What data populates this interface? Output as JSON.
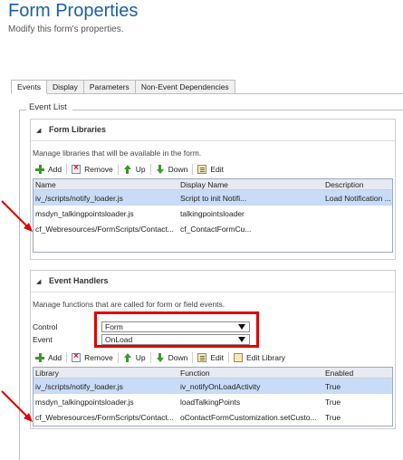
{
  "header": {
    "title": "Form Properties",
    "subtitle": "Modify this form's properties."
  },
  "tabs": [
    {
      "label": "Events",
      "active": true
    },
    {
      "label": "Display",
      "active": false
    },
    {
      "label": "Parameters",
      "active": false
    },
    {
      "label": "Non-Event Dependencies",
      "active": false
    }
  ],
  "event_list": {
    "label": "Event List",
    "form_libraries": {
      "title": "Form Libraries",
      "description": "Manage libraries that will be available in the form.",
      "toolbar": {
        "add": "Add",
        "remove": "Remove",
        "up": "Up",
        "down": "Down",
        "edit": "Edit"
      },
      "columns": [
        "Name",
        "Display Name",
        "Description"
      ],
      "rows": [
        {
          "name": "iv_/scripts/notify_loader.js",
          "display": "Script to init Notifi...",
          "desc": "Load Notification ...",
          "selected": true
        },
        {
          "name": "msdyn_talkingpointsloader.js",
          "display": "talkingpointsloader",
          "desc": "",
          "selected": false
        },
        {
          "name": "cf_Webresources/FormScripts/Contact...",
          "display": "cf_ContactFormCu...",
          "desc": "",
          "selected": false
        }
      ]
    },
    "event_handlers": {
      "title": "Event Handlers",
      "description": "Manage functions that are called for form or field events.",
      "control_label": "Control",
      "control_value": "Form",
      "event_label": "Event",
      "event_value": "OnLoad",
      "toolbar": {
        "add": "Add",
        "remove": "Remove",
        "up": "Up",
        "down": "Down",
        "edit": "Edit",
        "edit_library": "Edit Library"
      },
      "columns": [
        "Library",
        "Function",
        "Enabled"
      ],
      "rows": [
        {
          "library": "iv_/scripts/notify_loader.js",
          "function": "iv_notifyOnLoadActivity",
          "enabled": "True",
          "selected": true
        },
        {
          "library": "msdyn_talkingpointsloader.js",
          "function": "loadTalkingPoints",
          "enabled": "True",
          "selected": false
        },
        {
          "library": "cf_Webresources/FormScripts/Contact...",
          "function": "oContactFormCustomization.setCusto...",
          "enabled": "True",
          "selected": false
        }
      ]
    }
  },
  "colors": {
    "accent": "#1a5fa8",
    "selection": "#c9dcf7",
    "highlight": "#e00000"
  }
}
